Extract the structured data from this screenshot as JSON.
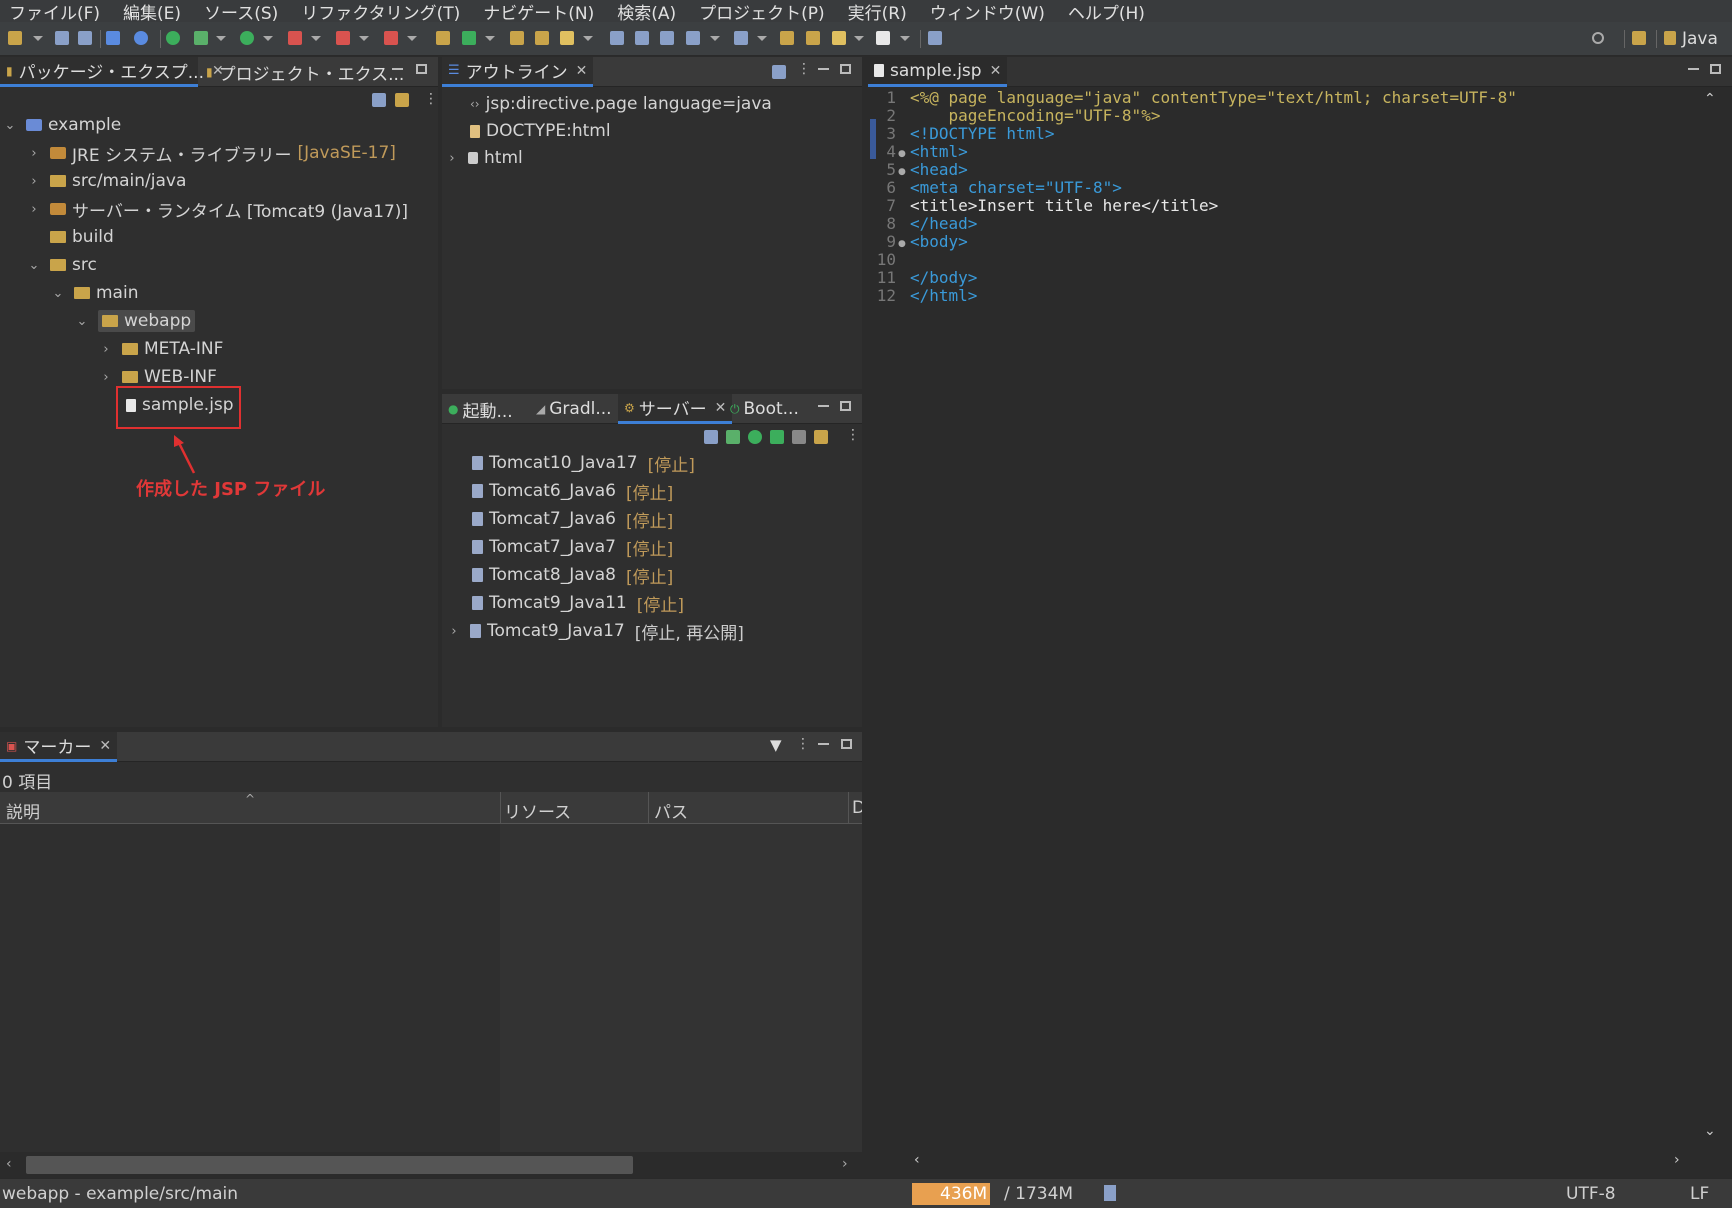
{
  "menu": [
    "ファイル(F)",
    "編集(E)",
    "ソース(S)",
    "リファクタリング(T)",
    "ナビゲート(N)",
    "検索(A)",
    "プロジェクト(P)",
    "実行(R)",
    "ウィンドウ(W)",
    "ヘルプ(H)"
  ],
  "toolbar": {
    "perspective_label": "Java"
  },
  "explorer": {
    "tabs": [
      "パッケージ・エクスプ...",
      "プロジェクト・エクス..."
    ],
    "tree": [
      {
        "label": "example",
        "suffix": ""
      },
      {
        "label": "JRE システム・ライブラリー",
        "suffix": "[JavaSE-17]"
      },
      {
        "label": "src/main/java",
        "suffix": ""
      },
      {
        "label": "サーバー・ランタイム [Tomcat9 (Java17)]",
        "suffix": ""
      },
      {
        "label": "build",
        "suffix": ""
      },
      {
        "label": "src",
        "suffix": ""
      },
      {
        "label": "main",
        "suffix": ""
      },
      {
        "label": "webapp",
        "suffix": ""
      },
      {
        "label": "META-INF",
        "suffix": ""
      },
      {
        "label": "WEB-INF",
        "suffix": ""
      },
      {
        "label": "sample.jsp",
        "suffix": ""
      }
    ],
    "annotation": "作成した JSP ファイル"
  },
  "outline": {
    "tab": "アウトライン",
    "items": [
      "jsp:directive.page language=java",
      "DOCTYPE:html",
      "html"
    ]
  },
  "servers": {
    "tabs": [
      "起動...",
      "Gradl...",
      "サーバー",
      "Boot..."
    ],
    "items": [
      {
        "name": "Tomcat10_Java17",
        "state": "[停止]"
      },
      {
        "name": "Tomcat6_Java6",
        "state": "[停止]"
      },
      {
        "name": "Tomcat7_Java6",
        "state": "[停止]"
      },
      {
        "name": "Tomcat7_Java7",
        "state": "[停止]"
      },
      {
        "name": "Tomcat8_Java8",
        "state": "[停止]"
      },
      {
        "name": "Tomcat9_Java11",
        "state": "[停止]"
      },
      {
        "name": "Tomcat9_Java17",
        "state": "[停止, 再公開]"
      }
    ]
  },
  "markers": {
    "tab": "マーカー",
    "count": "0 項目",
    "columns": [
      "説明",
      "リソース",
      "パス",
      "D"
    ]
  },
  "editor": {
    "tab": "sample.jsp",
    "line_numbers": [
      "1",
      "2",
      "3",
      "4",
      "5",
      "6",
      "7",
      "8",
      "9",
      "10",
      "11",
      "12"
    ],
    "lines": [
      "<%@ page language=\"java\" contentType=\"text/html; charset=UTF-8\"",
      "    pageEncoding=\"UTF-8\"%>",
      "<!DOCTYPE html>",
      "<html>",
      "<head>",
      "<meta charset=\"UTF-8\">",
      "<title>Insert title here</title>",
      "</head>",
      "<body>",
      "",
      "</body>",
      "</html>"
    ]
  },
  "status": {
    "left": "webapp - example/src/main",
    "heap_used": "436M",
    "heap_total": "/ 1734M",
    "heap_fraction": 0.25,
    "encoding": "UTF-8",
    "line_ending": "LF"
  }
}
